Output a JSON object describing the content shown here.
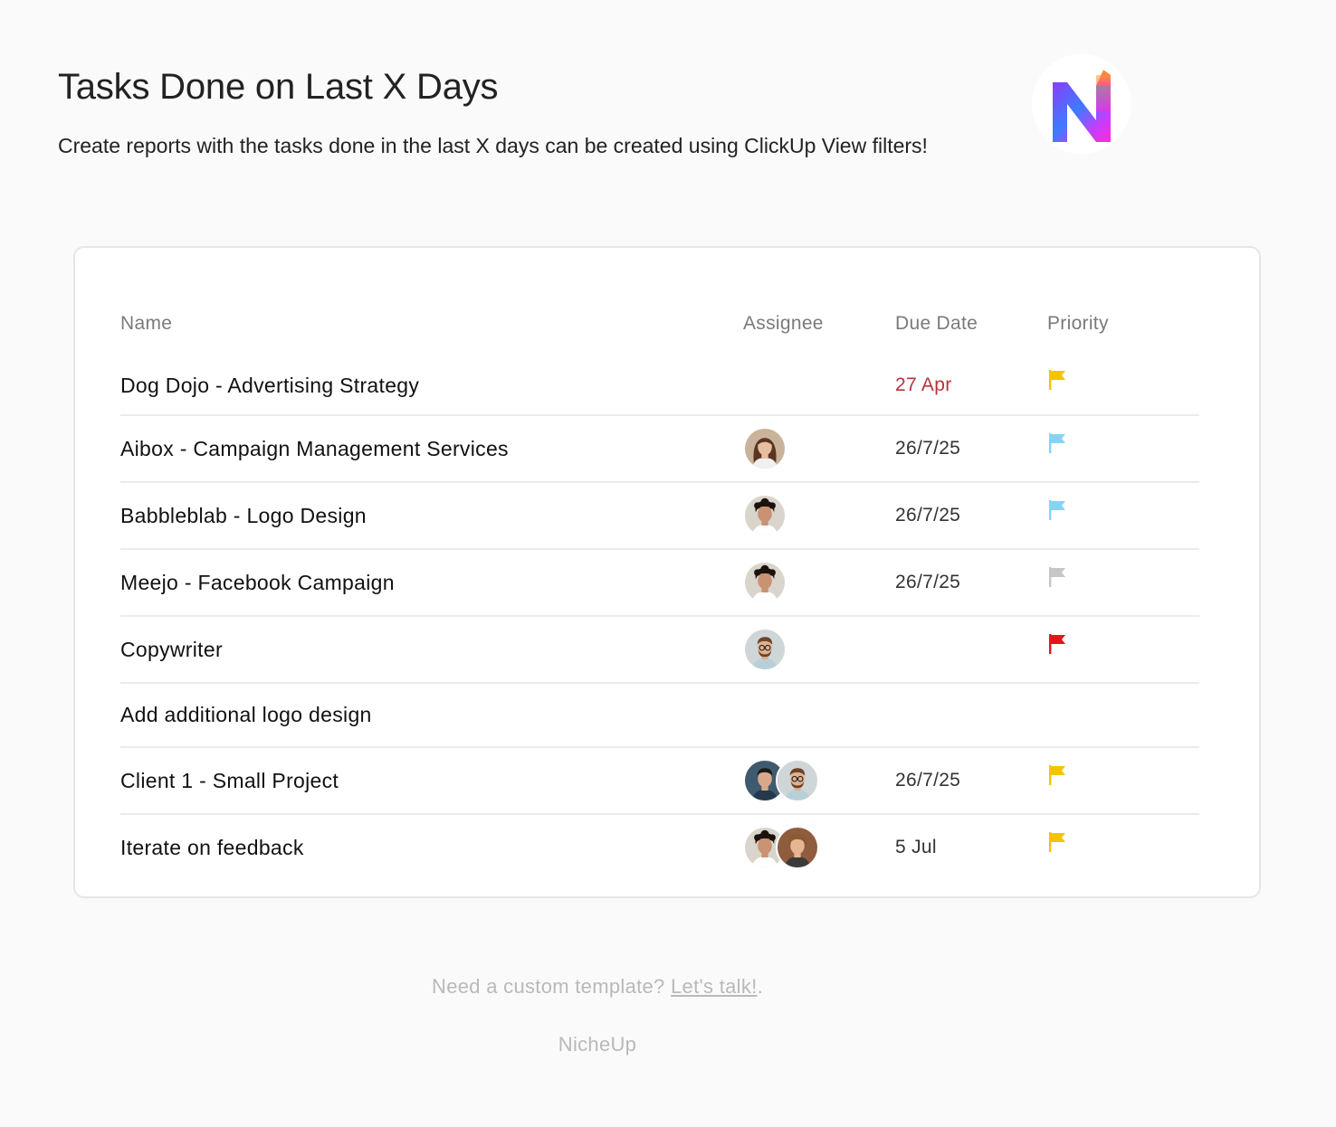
{
  "header": {
    "title": "Tasks Done on Last X Days",
    "subtitle": "Create reports with the tasks done in the last X days can be created using ClickUp View filters!"
  },
  "logo": {
    "icon": "nicheup-logo-icon",
    "colors": [
      "#3d7bff",
      "#8a3dff",
      "#ff2bd6",
      "#ff9f1c"
    ]
  },
  "table": {
    "columns": {
      "name": "Name",
      "assignee": "Assignee",
      "due_date": "Due Date",
      "priority": "Priority"
    },
    "rows": [
      {
        "name": "Dog Dojo - Advertising Strategy",
        "assignees": [],
        "due_date": "27 Apr",
        "due_overdue": true,
        "priority": "high",
        "priority_color": "#f5c400"
      },
      {
        "name": "Aibox - Campaign Management Services",
        "assignees": [
          "woman-long-hair"
        ],
        "due_date": "26/7/25",
        "due_overdue": false,
        "priority": "low",
        "priority_color": "#86d4f5"
      },
      {
        "name": "Babbleblab - Logo Design",
        "assignees": [
          "man-curly-hair"
        ],
        "due_date": "26/7/25",
        "due_overdue": false,
        "priority": "low",
        "priority_color": "#86d4f5"
      },
      {
        "name": "Meejo - Facebook Campaign",
        "assignees": [
          "man-curly-hair"
        ],
        "due_date": "26/7/25",
        "due_overdue": false,
        "priority": "none",
        "priority_color": "#c6c6c6"
      },
      {
        "name": "Copywriter",
        "assignees": [
          "man-glasses-beard"
        ],
        "due_date": "",
        "due_overdue": false,
        "priority": "urgent",
        "priority_color": "#e8141c"
      },
      {
        "name": "Add additional logo design",
        "assignees": [],
        "due_date": "",
        "due_overdue": false,
        "priority": "",
        "priority_color": ""
      },
      {
        "name": "Client 1 - Small Project",
        "assignees": [
          "man-dark-hair",
          "man-glasses-beard"
        ],
        "due_date": "26/7/25",
        "due_overdue": false,
        "priority": "high",
        "priority_color": "#f5c400"
      },
      {
        "name": "Iterate on feedback",
        "assignees": [
          "man-curly-hair",
          "man-wavy-hair"
        ],
        "due_date": "5 Jul",
        "due_overdue": false,
        "priority": "high",
        "priority_color": "#f5c400"
      }
    ]
  },
  "footer": {
    "cta_prefix": "Need a custom template? ",
    "cta_link": "Let's talk!",
    "cta_suffix": ".",
    "brand": "NicheUp"
  }
}
